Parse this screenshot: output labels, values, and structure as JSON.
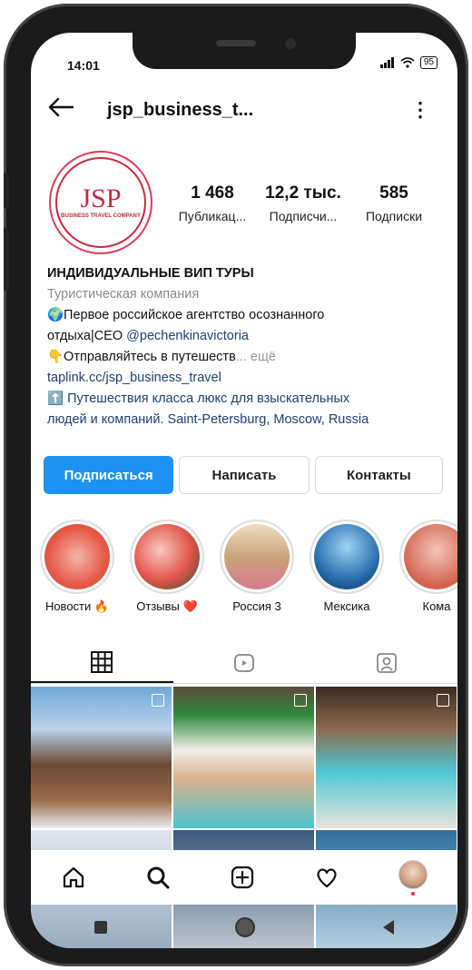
{
  "status": {
    "time": "14:01",
    "battery": "95"
  },
  "header": {
    "username": "jsp_business_t..."
  },
  "avatar": {
    "logo_text": "JSP",
    "logo_sub": "BUSINESS TRAVEL COMPANY"
  },
  "stats": [
    {
      "value": "1 468",
      "label": "Публикац..."
    },
    {
      "value": "12,2 тыс.",
      "label": "Подписчи..."
    },
    {
      "value": "585",
      "label": "Подписки"
    }
  ],
  "bio": {
    "name": "ИНДИВИДУАЛЬНЫЕ ВИП ТУРЫ",
    "category": "Туристическая компания",
    "line1": "🌍Первое российское агентство осознанного",
    "line2_prefix": "отдыха|CEO ",
    "line2_mention": "@pechenkinavictoria",
    "line3": "👇Отправляйтесь в путешеств",
    "line3_more": "... ещё",
    "link": "taplink.cc/jsp_business_travel",
    "tagline1": "⬆️ Путешествия класса люкс для взыскательных",
    "tagline2": "людей и компаний. Saint-Petersburg, Moscow, Russia"
  },
  "buttons": {
    "follow": "Подписаться",
    "message": "Написать",
    "contacts": "Контакты"
  },
  "highlights": [
    {
      "label": "Новости 🔥"
    },
    {
      "label": "Отзывы ❤️"
    },
    {
      "label": "Россия 3"
    },
    {
      "label": "Мексика"
    },
    {
      "label": "Кома"
    }
  ],
  "tabs": [
    "grid-icon",
    "reels-icon",
    "tagged-icon"
  ],
  "nav": [
    "home-icon",
    "search-icon",
    "add-icon",
    "heart-icon",
    "profile-avatar"
  ],
  "colors": {
    "accent": "#1d92f2",
    "brand_red": "#c32b3b",
    "link_blue": "#1f3f75"
  }
}
